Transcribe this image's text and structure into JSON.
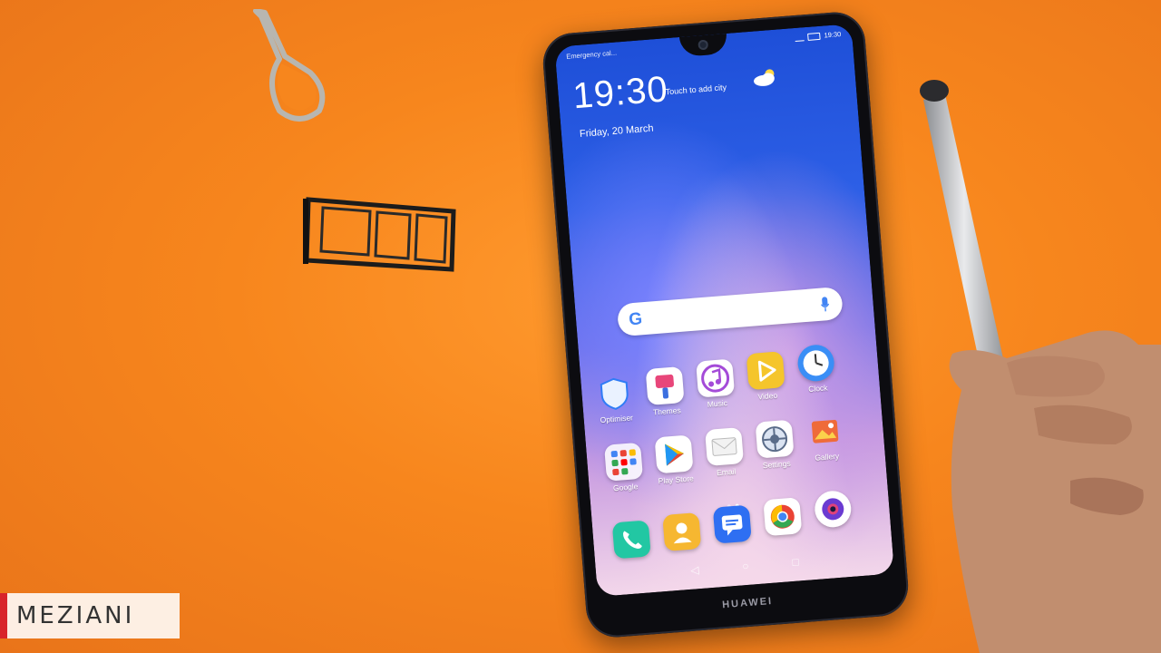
{
  "status_bar": {
    "carrier": "Emergency cal...",
    "time": "19:30"
  },
  "lock_widget": {
    "time": "19:30",
    "city_prompt": "Touch to add city",
    "date": "Friday, 20 March",
    "weather_icon": "partly-cloudy-icon"
  },
  "search_bar": {
    "logo": "G",
    "mic_icon": "mic-icon"
  },
  "home_apps": [
    {
      "label": "Optimiser",
      "icon": "shield-icon",
      "color": "#2f7cf6"
    },
    {
      "label": "Themes",
      "icon": "paintbrush-icon",
      "color": "#e8467a"
    },
    {
      "label": "Music",
      "icon": "music-note-icon",
      "color": "#a44bd8"
    },
    {
      "label": "Video",
      "icon": "play-icon",
      "color": "#f5c52b"
    },
    {
      "label": "Clock",
      "icon": "clock-icon",
      "color": "#3a8ef6"
    },
    {
      "label": "Google",
      "icon": "google-folder-icon",
      "color": "#ffffff"
    },
    {
      "label": "Play Store",
      "icon": "play-store-icon",
      "color": "#00c58b"
    },
    {
      "label": "Email",
      "icon": "envelope-icon",
      "color": "#e2e2e2"
    },
    {
      "label": "Settings",
      "icon": "gear-icon",
      "color": "#5a6c89"
    },
    {
      "label": "Gallery",
      "icon": "gallery-icon",
      "color": "#ef6b3a"
    }
  ],
  "dock_apps": [
    {
      "label": "Phone",
      "icon": "phone-icon",
      "color": "#22c7a3"
    },
    {
      "label": "Contacts",
      "icon": "contacts-icon",
      "color": "#f6b731"
    },
    {
      "label": "Messages",
      "icon": "messages-icon",
      "color": "#2e6ff2"
    },
    {
      "label": "Chrome",
      "icon": "chrome-icon",
      "color": "#ffffff"
    },
    {
      "label": "Camera",
      "icon": "camera-icon",
      "color": "#6a3bd1"
    }
  ],
  "page_indicator": {
    "count": 2,
    "active": 1
  },
  "navigation": {
    "back": "◁",
    "home": "○",
    "recents": "□"
  },
  "device_brand": "HUAWEI",
  "watermark": "MEZIANI"
}
